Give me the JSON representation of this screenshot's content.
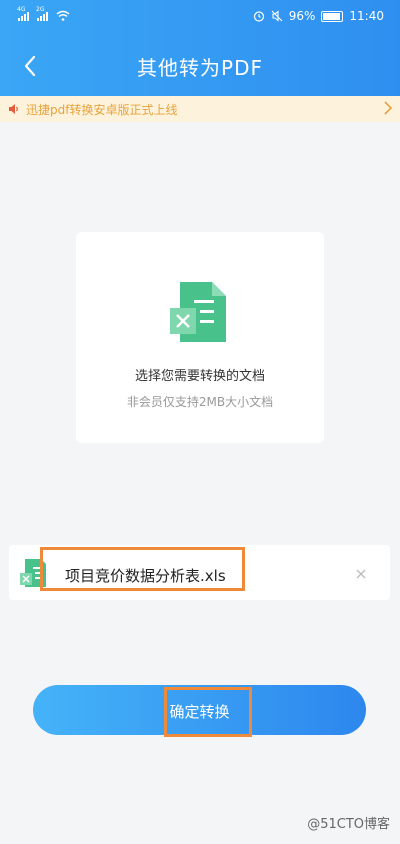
{
  "status_bar": {
    "network_left": "4G",
    "network_right": "2G",
    "battery": "96%",
    "time": "11:40"
  },
  "header": {
    "title": "其他转为PDF",
    "back_icon": "chevron-left-icon"
  },
  "notice": {
    "text": "迅捷pdf转换安卓版正式上线",
    "color": "#e8a23b"
  },
  "upload": {
    "main_text": "选择您需要转换的文档",
    "sub_text": "非会员仅支持2MB大小文档"
  },
  "file": {
    "name": "项目竞价数据分析表.xls",
    "remove_icon": "close-icon"
  },
  "action": {
    "confirm_label": "确定转换"
  },
  "watermark": "@51CTO博客",
  "colors": {
    "primary": "#2f8ff0",
    "doc_green": "#49c18b",
    "highlight": "#ee8a3a"
  }
}
